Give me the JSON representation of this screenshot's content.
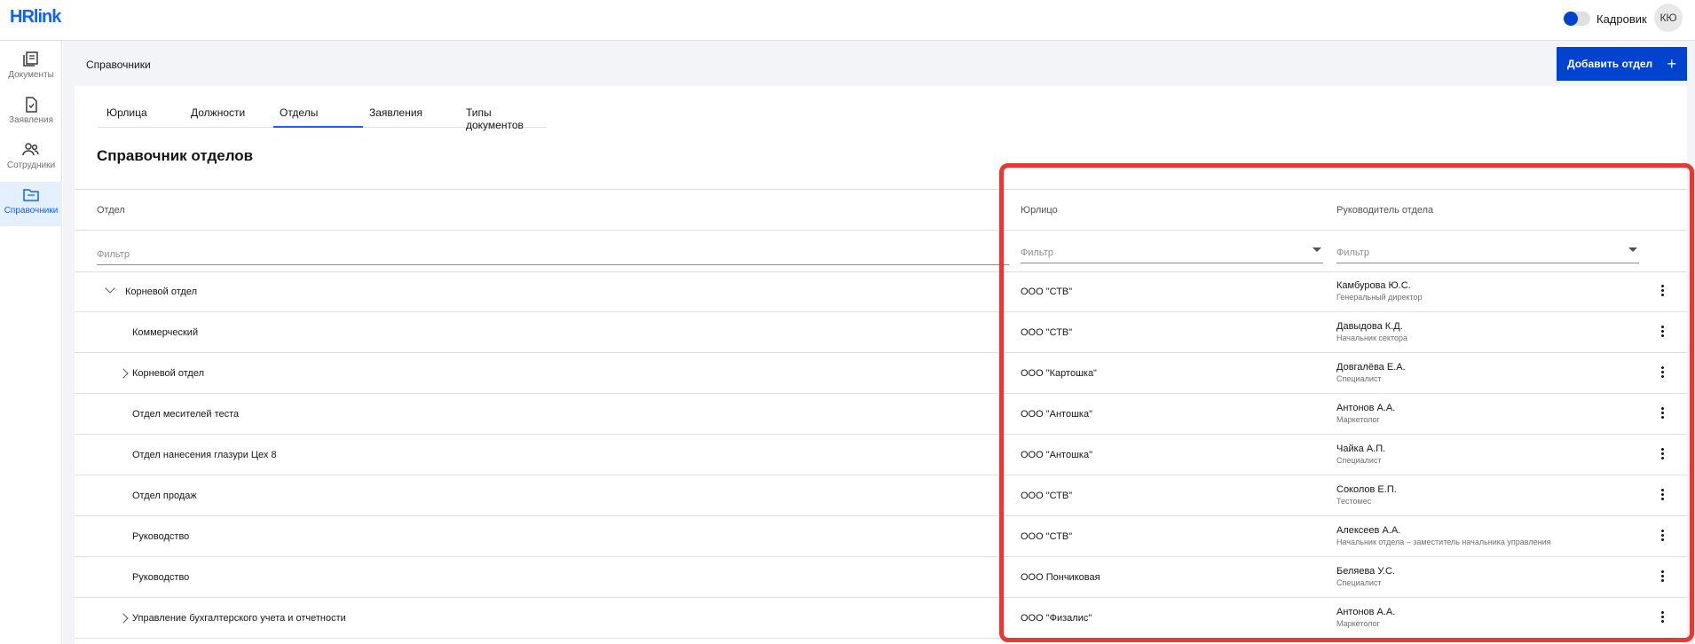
{
  "header": {
    "logo_text": "HRlink",
    "role_label": "Кадровик",
    "avatar_initials": "КЮ",
    "accent": "#0f62fe"
  },
  "sidebar": {
    "items": [
      {
        "label": "Документы",
        "icon": "documents-icon",
        "active": false
      },
      {
        "label": "Заявления",
        "icon": "application-icon",
        "active": false
      },
      {
        "label": "Сотрудники",
        "icon": "people-icon",
        "active": false
      },
      {
        "label": "Справочники",
        "icon": "folder-icon",
        "active": true
      }
    ]
  },
  "breadcrumb": "Справочники",
  "add_button_label": "Добавить отдел",
  "tabs": [
    {
      "label": "Юрлица",
      "active": false
    },
    {
      "label": "Должности",
      "active": false
    },
    {
      "label": "Отделы",
      "active": true
    },
    {
      "label": "Заявления",
      "active": false
    },
    {
      "label": "Типы документов",
      "active": false
    }
  ],
  "page_title": "Справочник отделов",
  "table": {
    "columns": {
      "dept": "Отдел",
      "entity": "Юрлицо",
      "manager": "Руководитель отдела"
    },
    "filter_placeholder": "Фильтр",
    "rows": [
      {
        "dept": "Корневой отдел",
        "entity": "ООО \"СТВ\"",
        "manager": "Камбурова Ю.С.",
        "position": "Генеральный директор",
        "chevron": "down",
        "level": 0
      },
      {
        "dept": "Коммерческий",
        "entity": "ООО \"СТВ\"",
        "manager": "Давыдова К.Д.",
        "position": "Начальник сектора",
        "chevron": "none",
        "level": 1
      },
      {
        "dept": "Корневой отдел",
        "entity": "ООО \"Картошка\"",
        "manager": "Довгалёва Е.А.",
        "position": "Специалист",
        "chevron": "right",
        "level": 1
      },
      {
        "dept": "Отдел месителей теста",
        "entity": "ООО \"Антошка\"",
        "manager": "Антонов А.А.",
        "position": "Маркетолог",
        "chevron": "none",
        "level": 1
      },
      {
        "dept": "Отдел нанесения глазури Цех 8",
        "entity": "ООО \"Антошка\"",
        "manager": "Чайка А.П.",
        "position": "Специалист",
        "chevron": "none",
        "level": 1
      },
      {
        "dept": "Отдел продаж",
        "entity": "ООО \"СТВ\"",
        "manager": "Соколов Е.П.",
        "position": "Тестомес",
        "chevron": "none",
        "level": 1
      },
      {
        "dept": "Руководство",
        "entity": "ООО \"СТВ\"",
        "manager": "Алексеев А.А.",
        "position": "Начальник отдела – заместитель начальника управления",
        "chevron": "none",
        "level": 1
      },
      {
        "dept": "Руководство",
        "entity": "ООО Пончиковая",
        "manager": "Беляева У.С.",
        "position": "Специалист",
        "chevron": "none",
        "level": 1
      },
      {
        "dept": "Управление бухгалтерского учета и отчетности",
        "entity": "ООО \"Физалис\"",
        "manager": "Антонов А.А.",
        "position": "Маркетолог",
        "chevron": "right",
        "level": 1
      }
    ]
  }
}
